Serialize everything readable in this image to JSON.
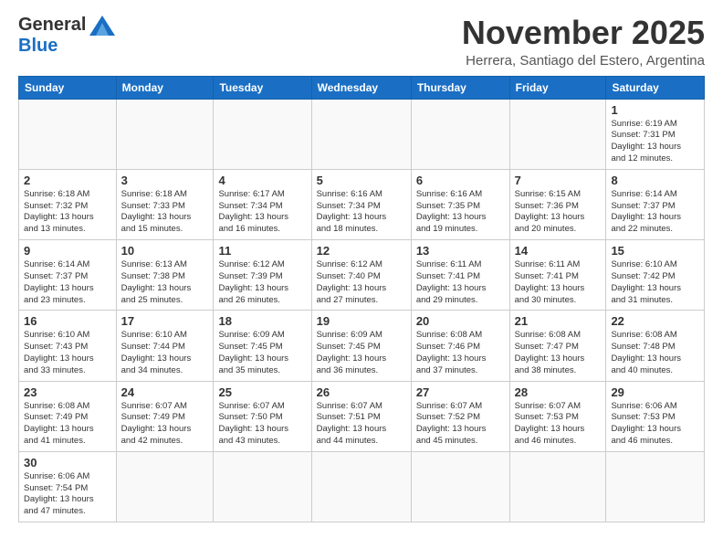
{
  "logo": {
    "general": "General",
    "blue": "Blue"
  },
  "title": "November 2025",
  "location": "Herrera, Santiago del Estero, Argentina",
  "days_of_week": [
    "Sunday",
    "Monday",
    "Tuesday",
    "Wednesday",
    "Thursday",
    "Friday",
    "Saturday"
  ],
  "weeks": [
    [
      {
        "day": "",
        "content": ""
      },
      {
        "day": "",
        "content": ""
      },
      {
        "day": "",
        "content": ""
      },
      {
        "day": "",
        "content": ""
      },
      {
        "day": "",
        "content": ""
      },
      {
        "day": "",
        "content": ""
      },
      {
        "day": "1",
        "content": "Sunrise: 6:19 AM\nSunset: 7:31 PM\nDaylight: 13 hours\nand 12 minutes."
      }
    ],
    [
      {
        "day": "2",
        "content": "Sunrise: 6:18 AM\nSunset: 7:32 PM\nDaylight: 13 hours\nand 13 minutes."
      },
      {
        "day": "3",
        "content": "Sunrise: 6:18 AM\nSunset: 7:33 PM\nDaylight: 13 hours\nand 15 minutes."
      },
      {
        "day": "4",
        "content": "Sunrise: 6:17 AM\nSunset: 7:34 PM\nDaylight: 13 hours\nand 16 minutes."
      },
      {
        "day": "5",
        "content": "Sunrise: 6:16 AM\nSunset: 7:34 PM\nDaylight: 13 hours\nand 18 minutes."
      },
      {
        "day": "6",
        "content": "Sunrise: 6:16 AM\nSunset: 7:35 PM\nDaylight: 13 hours\nand 19 minutes."
      },
      {
        "day": "7",
        "content": "Sunrise: 6:15 AM\nSunset: 7:36 PM\nDaylight: 13 hours\nand 20 minutes."
      },
      {
        "day": "8",
        "content": "Sunrise: 6:14 AM\nSunset: 7:37 PM\nDaylight: 13 hours\nand 22 minutes."
      }
    ],
    [
      {
        "day": "9",
        "content": "Sunrise: 6:14 AM\nSunset: 7:37 PM\nDaylight: 13 hours\nand 23 minutes."
      },
      {
        "day": "10",
        "content": "Sunrise: 6:13 AM\nSunset: 7:38 PM\nDaylight: 13 hours\nand 25 minutes."
      },
      {
        "day": "11",
        "content": "Sunrise: 6:12 AM\nSunset: 7:39 PM\nDaylight: 13 hours\nand 26 minutes."
      },
      {
        "day": "12",
        "content": "Sunrise: 6:12 AM\nSunset: 7:40 PM\nDaylight: 13 hours\nand 27 minutes."
      },
      {
        "day": "13",
        "content": "Sunrise: 6:11 AM\nSunset: 7:41 PM\nDaylight: 13 hours\nand 29 minutes."
      },
      {
        "day": "14",
        "content": "Sunrise: 6:11 AM\nSunset: 7:41 PM\nDaylight: 13 hours\nand 30 minutes."
      },
      {
        "day": "15",
        "content": "Sunrise: 6:10 AM\nSunset: 7:42 PM\nDaylight: 13 hours\nand 31 minutes."
      }
    ],
    [
      {
        "day": "16",
        "content": "Sunrise: 6:10 AM\nSunset: 7:43 PM\nDaylight: 13 hours\nand 33 minutes."
      },
      {
        "day": "17",
        "content": "Sunrise: 6:10 AM\nSunset: 7:44 PM\nDaylight: 13 hours\nand 34 minutes."
      },
      {
        "day": "18",
        "content": "Sunrise: 6:09 AM\nSunset: 7:45 PM\nDaylight: 13 hours\nand 35 minutes."
      },
      {
        "day": "19",
        "content": "Sunrise: 6:09 AM\nSunset: 7:45 PM\nDaylight: 13 hours\nand 36 minutes."
      },
      {
        "day": "20",
        "content": "Sunrise: 6:08 AM\nSunset: 7:46 PM\nDaylight: 13 hours\nand 37 minutes."
      },
      {
        "day": "21",
        "content": "Sunrise: 6:08 AM\nSunset: 7:47 PM\nDaylight: 13 hours\nand 38 minutes."
      },
      {
        "day": "22",
        "content": "Sunrise: 6:08 AM\nSunset: 7:48 PM\nDaylight: 13 hours\nand 40 minutes."
      }
    ],
    [
      {
        "day": "23",
        "content": "Sunrise: 6:08 AM\nSunset: 7:49 PM\nDaylight: 13 hours\nand 41 minutes."
      },
      {
        "day": "24",
        "content": "Sunrise: 6:07 AM\nSunset: 7:49 PM\nDaylight: 13 hours\nand 42 minutes."
      },
      {
        "day": "25",
        "content": "Sunrise: 6:07 AM\nSunset: 7:50 PM\nDaylight: 13 hours\nand 43 minutes."
      },
      {
        "day": "26",
        "content": "Sunrise: 6:07 AM\nSunset: 7:51 PM\nDaylight: 13 hours\nand 44 minutes."
      },
      {
        "day": "27",
        "content": "Sunrise: 6:07 AM\nSunset: 7:52 PM\nDaylight: 13 hours\nand 45 minutes."
      },
      {
        "day": "28",
        "content": "Sunrise: 6:07 AM\nSunset: 7:53 PM\nDaylight: 13 hours\nand 46 minutes."
      },
      {
        "day": "29",
        "content": "Sunrise: 6:06 AM\nSunset: 7:53 PM\nDaylight: 13 hours\nand 46 minutes."
      }
    ],
    [
      {
        "day": "30",
        "content": "Sunrise: 6:06 AM\nSunset: 7:54 PM\nDaylight: 13 hours\nand 47 minutes."
      },
      {
        "day": "",
        "content": ""
      },
      {
        "day": "",
        "content": ""
      },
      {
        "day": "",
        "content": ""
      },
      {
        "day": "",
        "content": ""
      },
      {
        "day": "",
        "content": ""
      },
      {
        "day": "",
        "content": ""
      }
    ]
  ]
}
